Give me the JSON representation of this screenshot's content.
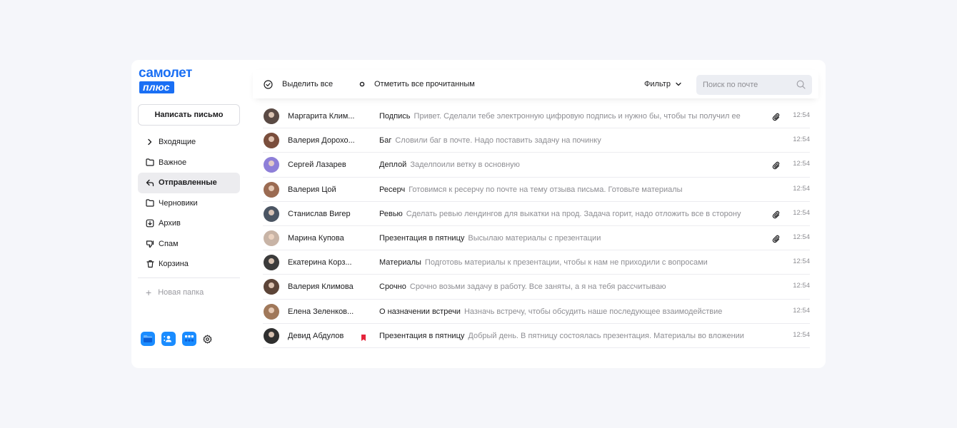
{
  "brand": {
    "logo_top": "самолет",
    "logo_bottom": "плюс",
    "accent_color": "#1a6ff4"
  },
  "toolbar": {
    "select_all": "Выделить все",
    "mark_all_read": "Отметить все прочитанным",
    "filter": "Фильтр",
    "search_placeholder": "Поиск по почте"
  },
  "sidebar": {
    "compose": "Написать письмо",
    "items": [
      {
        "label": "Входящие",
        "icon": "chevron-right-icon"
      },
      {
        "label": "Важное",
        "icon": "folder-icon"
      },
      {
        "label": "Отправленные",
        "icon": "reply-icon",
        "active": true
      },
      {
        "label": "Черновики",
        "icon": "folder-icon"
      },
      {
        "label": "Архив",
        "icon": "archive-icon"
      },
      {
        "label": "Спам",
        "icon": "thumbs-down-icon"
      },
      {
        "label": "Корзина",
        "icon": "trash-icon"
      }
    ],
    "new_folder": "Новая папка",
    "apps": [
      "files-app-icon",
      "contacts-app-icon",
      "apps-grid-icon",
      "settings-gear-icon"
    ]
  },
  "messages": [
    {
      "sender": "Маргарита Клим...",
      "subject": "Подпись",
      "preview": "Привет. Сделали тебе электронную цифровую подпись и нужно бы, чтобы ты получил ее",
      "attachment": true,
      "flag": false,
      "time": "12:54",
      "avatar_color": "#5a4a44"
    },
    {
      "sender": "Валерия Дорохо...",
      "subject": "Баг",
      "preview": "Словили баг в почте. Надо поставить задачу на починку",
      "attachment": false,
      "flag": false,
      "time": "12:54",
      "avatar_color": "#7a4e3c"
    },
    {
      "sender": "Сергей Лазарев",
      "subject": "Деплой",
      "preview": "Заделпоили ветку в основную",
      "attachment": true,
      "flag": false,
      "time": "12:54",
      "avatar_color": "#8e7fd8"
    },
    {
      "sender": "Валерия Цой",
      "subject": "Ресерч",
      "preview": "Готовимся к ресерчу по почте на тему отзыва письма. Готовьте материалы",
      "attachment": false,
      "flag": false,
      "time": "12:54",
      "avatar_color": "#9b6b52"
    },
    {
      "sender": "Станислав Вигер",
      "subject": "Ревью",
      "preview": "Сделать ревью лендингов для выкатки на прод. Задача горит, надо отложить все в сторону",
      "attachment": true,
      "flag": false,
      "time": "12:54",
      "avatar_color": "#4b5563"
    },
    {
      "sender": "Марина Купова",
      "subject": "Презентация в пятницу",
      "preview": "Высылаю материалы с презентации",
      "attachment": true,
      "flag": false,
      "time": "12:54",
      "avatar_color": "#c8b4a6"
    },
    {
      "sender": "Екатерина Корз...",
      "subject": "Материалы",
      "preview": "Подготовь материалы к презентации, чтобы к нам не приходили с вопросами",
      "attachment": false,
      "flag": false,
      "time": "12:54",
      "avatar_color": "#3b3b3b"
    },
    {
      "sender": "Валерия Климова",
      "subject": "Срочно",
      "preview": "Срочно возьми задачу в работу. Все заняты, а я на тебя рассчитываю",
      "attachment": false,
      "flag": false,
      "time": "12:54",
      "avatar_color": "#5c4438"
    },
    {
      "sender": "Елена Зеленков...",
      "subject": "О назначении встречи",
      "preview": "Назначь встречу, чтобы обсудить наше последующее взаимодействие",
      "attachment": false,
      "flag": false,
      "time": "12:54",
      "avatar_color": "#a0785a"
    },
    {
      "sender": "Девид Абдулов",
      "subject": "Презентация в пятницу",
      "preview": "Добрый день. В пятницу состоялась презентация. Материалы во вложении",
      "attachment": false,
      "flag": true,
      "time": "12:54",
      "avatar_color": "#2f2f2f"
    }
  ],
  "colors": {
    "flag": "#e5243b",
    "app_blue": "#1a8cff"
  }
}
